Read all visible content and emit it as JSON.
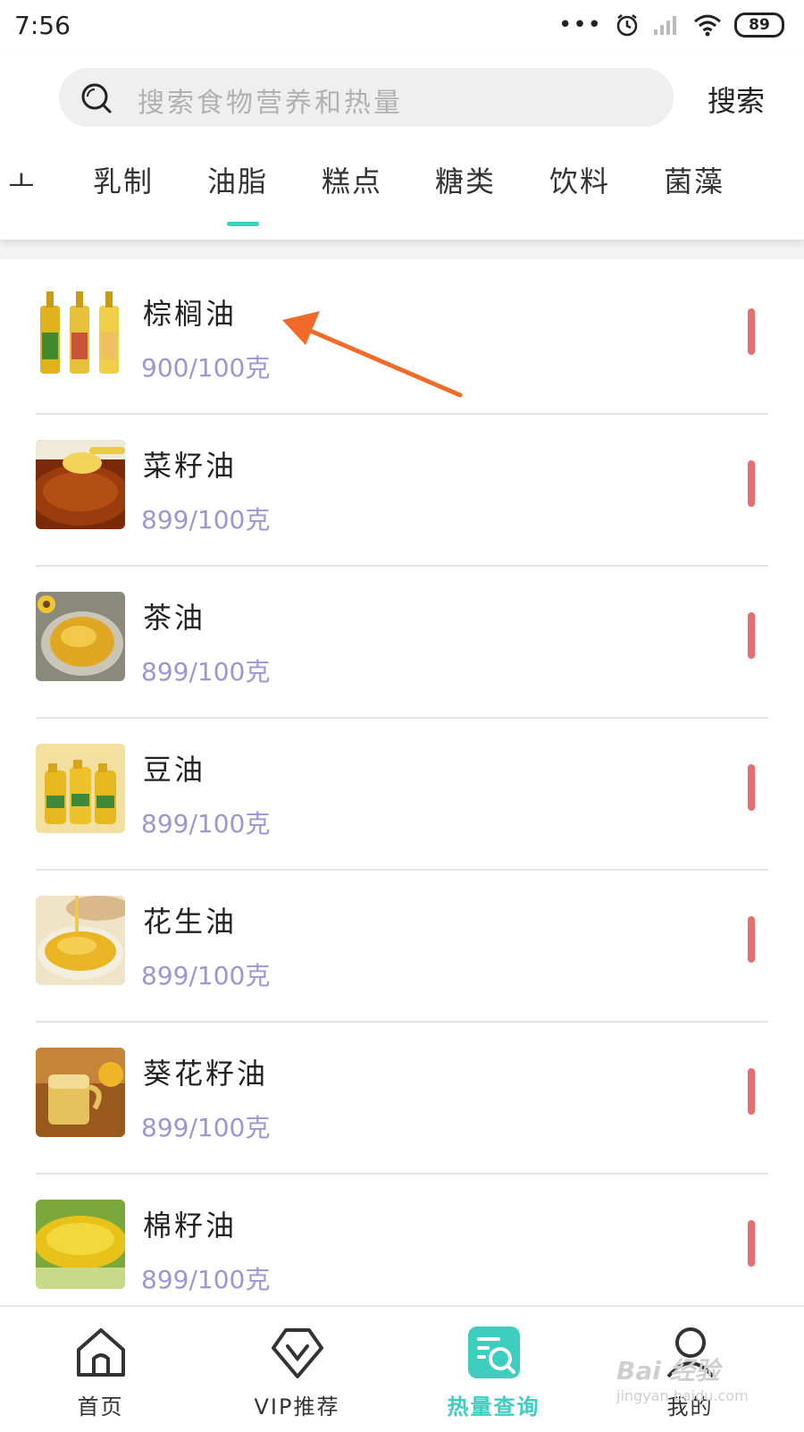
{
  "status_bar": {
    "time": "7:56",
    "dots": "•••",
    "battery": "89"
  },
  "search": {
    "placeholder": "搜索食物营养和热量",
    "button_label": "搜索"
  },
  "tabs": [
    {
      "label": "乳制"
    },
    {
      "label": "油脂",
      "active": true
    },
    {
      "label": "糕点"
    },
    {
      "label": "糖类"
    },
    {
      "label": "饮料"
    },
    {
      "label": "菌藻"
    }
  ],
  "tab_partial_label": "ㅗ",
  "foods": [
    {
      "name": "棕榈油",
      "kcal": "900/100克"
    },
    {
      "name": "菜籽油",
      "kcal": "899/100克"
    },
    {
      "name": "茶油",
      "kcal": "899/100克"
    },
    {
      "name": "豆油",
      "kcal": "899/100克"
    },
    {
      "name": "花生油",
      "kcal": "899/100克"
    },
    {
      "name": "葵花籽油",
      "kcal": "899/100克"
    },
    {
      "name": "棉籽油",
      "kcal": "899/100克"
    }
  ],
  "bottom_nav": [
    {
      "label": "首页",
      "icon": "home-icon"
    },
    {
      "label": "VIP推荐",
      "icon": "vip-icon"
    },
    {
      "label": "热量查询",
      "icon": "calorie-search-icon",
      "active": true
    },
    {
      "label": "我的",
      "icon": "profile-icon"
    }
  ],
  "watermark": {
    "text": "Bai 经验",
    "sub": "jingyan.baidu.com"
  },
  "colors": {
    "accent": "#3ccfc0",
    "kcal_text": "#9b96d4",
    "bar": "#e76d6f",
    "annotation_arrow": "#f06a2a"
  }
}
